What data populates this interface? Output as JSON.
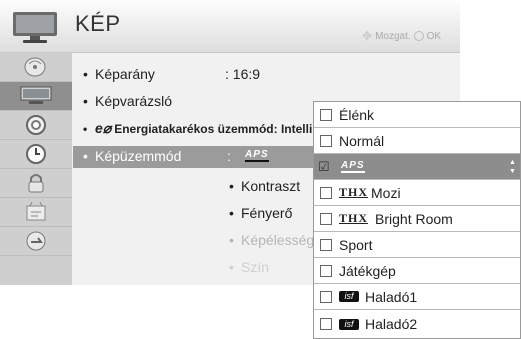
{
  "header": {
    "title": "KÉP",
    "nav_hint": "Mozgat.",
    "ok_label": "OK",
    "icon": "tv-icon"
  },
  "sidebar": {
    "items": [
      {
        "icon": "satellite-dish-icon"
      },
      {
        "icon": "picture-tv-icon",
        "active": true
      },
      {
        "icon": "speaker-icon"
      },
      {
        "icon": "clock-icon"
      },
      {
        "icon": "lock-icon"
      },
      {
        "icon": "options-box-icon"
      },
      {
        "icon": "input-connection-icon"
      }
    ]
  },
  "menu": {
    "aspect_label": "Képarány",
    "aspect_value": ": 16:9",
    "wizard_label": "Képvarázsló",
    "energy_label": "Energiatakarékos üzemmód: Intelli",
    "mode_label": "Képüzemmód",
    "mode_sep": ":",
    "mode_value": "APS",
    "contrast_label": "Kontraszt",
    "brightness_label": "Fényerő",
    "sharpness_label": "Képélesség",
    "color_label": "Szín"
  },
  "dropdown": {
    "options": [
      {
        "label": "Élénk"
      },
      {
        "label": "Normál"
      },
      {
        "label": "APS",
        "selected": true
      },
      {
        "prefix": "THX",
        "label": "Mozi"
      },
      {
        "prefix": "THX",
        "label": "Bright Room"
      },
      {
        "label": "Sport"
      },
      {
        "label": "Játékgép"
      },
      {
        "prefix": "isf",
        "label": "Haladó1"
      },
      {
        "prefix": "isf",
        "label": "Haladó2"
      }
    ]
  }
}
